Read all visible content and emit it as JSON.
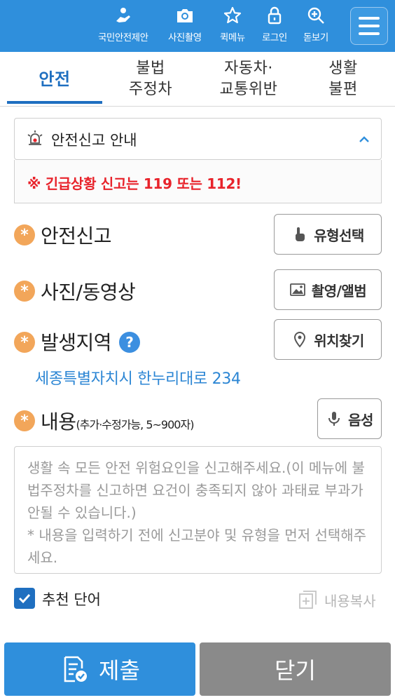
{
  "topbar": {
    "items": [
      {
        "label": "국민안전제안",
        "icon": "hand-heart-icon"
      },
      {
        "label": "사진촬영",
        "icon": "camera-icon"
      },
      {
        "label": "퀵메뉴",
        "icon": "star-icon"
      },
      {
        "label": "로그인",
        "icon": "lock-icon"
      },
      {
        "label": "돋보기",
        "icon": "magnifier-plus-icon"
      }
    ],
    "menu_icon": "hamburger-icon",
    "background": "#2f8fdc"
  },
  "tabs": [
    {
      "label": "안전",
      "active": true
    },
    {
      "label": "불법\n주정차",
      "active": false
    },
    {
      "label": "자동차·\n교통위반",
      "active": false
    },
    {
      "label": "생활\n불편",
      "active": false
    }
  ],
  "notice": {
    "title": "안전신고 안내",
    "emergency": "※ 긴급상황 신고는 119 또는 112!"
  },
  "form": {
    "safety_report": {
      "label": "안전신고",
      "button": "유형선택"
    },
    "media": {
      "label": "사진/동영상",
      "button": "촬영/앨범"
    },
    "region": {
      "label": "발생지역",
      "button": "위치찾기",
      "help": "?",
      "address": "세종특별자치시 한누리대로 234"
    },
    "content": {
      "label": "내용",
      "hint": "(추가·수정가능, 5~900자)",
      "button": "음성",
      "placeholder": "생활 속 모든 안전 위험요인을 신고해주세요.(이 메뉴에 불법주정차를 신고하면 요건이 충족되지 않아 과태료 부과가 안될 수 있습니다.)\n* 내용을 입력하기 전에 신고분야 및 유형을 먼저 선택해주세요."
    },
    "required_mark": "*"
  },
  "options": {
    "recommend_label": "추천 단어",
    "recommend_checked": true,
    "copy_label": "내용복사"
  },
  "actions": {
    "submit": "제출",
    "close": "닫기"
  },
  "colors": {
    "accent": "#2f8fdc",
    "tab_active": "#1f6fc0",
    "required": "#f2a65a",
    "emergency": "#e8232b",
    "address": "#2c86d4",
    "close_button": "#8a8a8a"
  }
}
